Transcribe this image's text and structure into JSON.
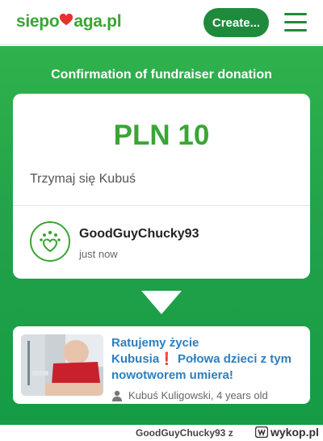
{
  "header": {
    "logo": {
      "part1": "siepo",
      "part2": "aga.pl"
    },
    "create_label": "Create..."
  },
  "hero": {
    "title": "Confirmation of fundraiser donation"
  },
  "donation": {
    "amount": "PLN 10",
    "message": "Trzymaj się Kubuś",
    "donor": "GoodGuyChucky93",
    "time": "just now"
  },
  "fundraiser": {
    "title_line1": "Ratujemy życie",
    "title_line2_a": "Kubusia",
    "title_line2_b": " Połowa dzieci z tym nowotworem umiera!",
    "meta": "Kubuś Kuligowski, 4 years old"
  },
  "footer": {
    "credit": "GoodGuyChucky93 z",
    "site": "wykop.pl"
  },
  "colors": {
    "brand_green": "#3aa535",
    "dark_green": "#1f8a3c",
    "link_blue": "#2c7fbf",
    "logo_red": "#e5322d"
  }
}
